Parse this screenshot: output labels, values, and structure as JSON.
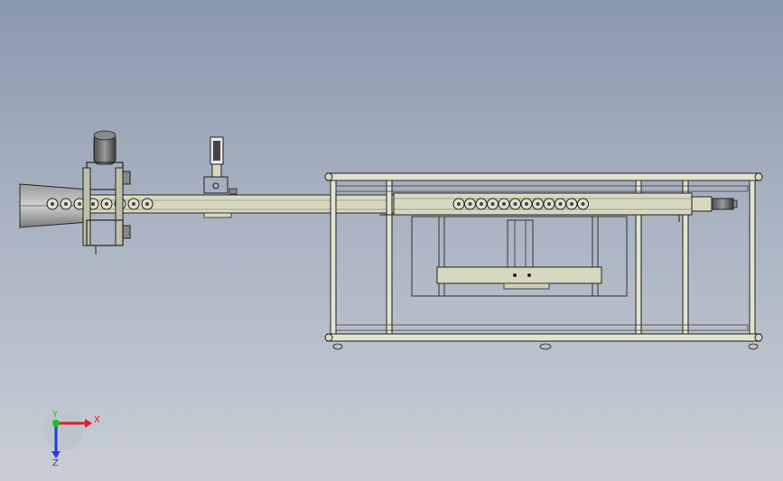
{
  "viewport": {
    "background_top": "#8b99ad",
    "background_bottom": "#c9ced6"
  },
  "model": {
    "part_fill": "#d8d8c0",
    "line_color": "#2a2a2a",
    "motor_color": "#6a6a6a",
    "roller_count_left": 8,
    "roller_count_right": 12
  },
  "triad": {
    "x_label": "X",
    "y_label": "Y",
    "z_label": "Z",
    "x_color": "#e02020",
    "y_color": "#20c020",
    "z_color": "#2040e0"
  }
}
